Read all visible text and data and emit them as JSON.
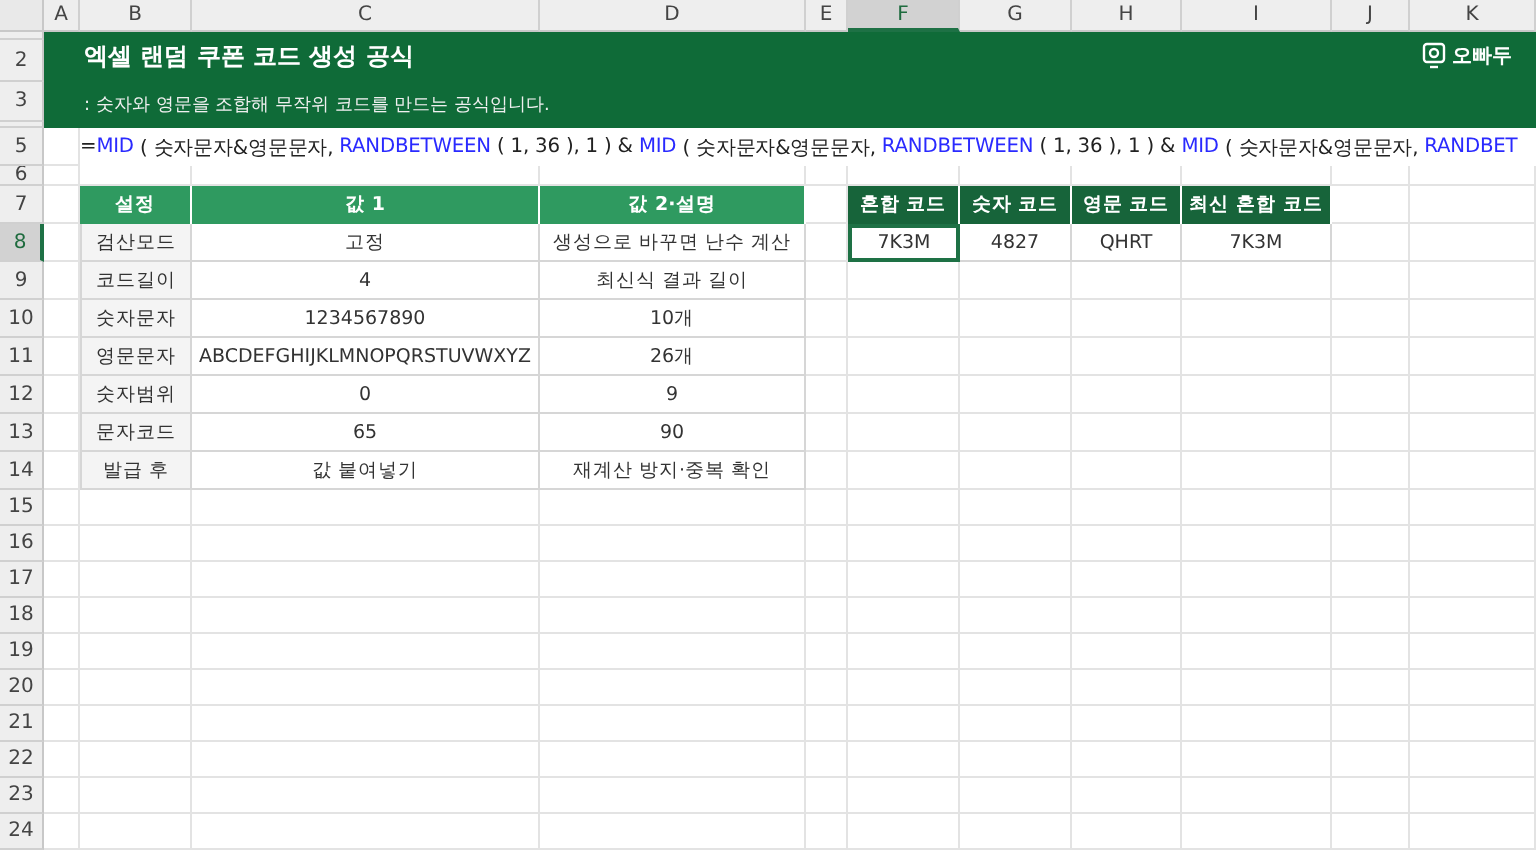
{
  "column_headers": [
    {
      "label": "A",
      "selected": false
    },
    {
      "label": "B",
      "selected": false
    },
    {
      "label": "C",
      "selected": false
    },
    {
      "label": "D",
      "selected": false
    },
    {
      "label": "E",
      "selected": false
    },
    {
      "label": "F",
      "selected": true
    },
    {
      "label": "G",
      "selected": false
    },
    {
      "label": "H",
      "selected": false
    },
    {
      "label": "I",
      "selected": false
    },
    {
      "label": "J",
      "selected": false
    },
    {
      "label": "K",
      "selected": false
    }
  ],
  "row_headers": [
    {
      "label": "2",
      "selected": false
    },
    {
      "label": "3",
      "selected": false
    },
    {
      "label": "5",
      "selected": false
    },
    {
      "label": "6",
      "selected": false
    },
    {
      "label": "7",
      "selected": false
    },
    {
      "label": "8",
      "selected": true
    },
    {
      "label": "9",
      "selected": false
    },
    {
      "label": "10",
      "selected": false
    },
    {
      "label": "11",
      "selected": false
    },
    {
      "label": "12",
      "selected": false
    },
    {
      "label": "13",
      "selected": false
    },
    {
      "label": "14",
      "selected": false
    },
    {
      "label": "15",
      "selected": false
    },
    {
      "label": "16",
      "selected": false
    },
    {
      "label": "17",
      "selected": false
    },
    {
      "label": "18",
      "selected": false
    },
    {
      "label": "19",
      "selected": false
    },
    {
      "label": "20",
      "selected": false
    },
    {
      "label": "21",
      "selected": false
    },
    {
      "label": "22",
      "selected": false
    },
    {
      "label": "23",
      "selected": false
    },
    {
      "label": "24",
      "selected": false
    }
  ],
  "banner": {
    "title": "엑셀 랜덤 쿠폰 코드 생성 공식",
    "subtitle": ": 숫자와 영문을 조합해 무작위 코드를 만드는 공식입니다.",
    "logo": "오빠두"
  },
  "formula": [
    {
      "kind": "plain",
      "text": "="
    },
    {
      "kind": "function",
      "text": "MID"
    },
    {
      "kind": "plain",
      "text": " ( 숫자문자&영문문자, "
    },
    {
      "kind": "function",
      "text": "RANDBETWEEN"
    },
    {
      "kind": "plain",
      "text": " ( 1, 36 ), 1 ) & "
    },
    {
      "kind": "function",
      "text": "MID"
    },
    {
      "kind": "plain",
      "text": " ( 숫자문자&영문문자, "
    },
    {
      "kind": "function",
      "text": "RANDBETWEEN"
    },
    {
      "kind": "plain",
      "text": " ( 1, 36 ), 1 ) & "
    },
    {
      "kind": "function",
      "text": "MID"
    },
    {
      "kind": "plain",
      "text": " ( 숫자문자&영문문자, "
    },
    {
      "kind": "function",
      "text": "RANDBET"
    }
  ],
  "settings_table": {
    "columns": [
      "설정",
      "값 1",
      "값 2·설명"
    ],
    "rows": [
      [
        "검산모드",
        "고정",
        "생성으로 바꾸면 난수 계산"
      ],
      [
        "코드길이",
        "4",
        "최신식 결과 길이"
      ],
      [
        "숫자문자",
        "1234567890",
        "10개"
      ],
      [
        "영문문자",
        "ABCDEFGHIJKLMNOPQRSTUVWXYZ",
        "26개"
      ],
      [
        "숫자범위",
        "0",
        "9"
      ],
      [
        "문자코드",
        "65",
        "90"
      ],
      [
        "발급 후",
        "값 붙여넣기",
        "재계산 방지·중복 확인"
      ]
    ]
  },
  "result_table": {
    "columns": [
      "혼합 코드",
      "숫자 코드",
      "영문 코드",
      "최신 혼합 코드"
    ],
    "cells": [
      {
        "text": "7K3M",
        "selected": true
      },
      {
        "text": "4827",
        "selected": false
      },
      {
        "text": "QHRT",
        "selected": false
      },
      {
        "text": "7K3M",
        "selected": false
      }
    ]
  }
}
